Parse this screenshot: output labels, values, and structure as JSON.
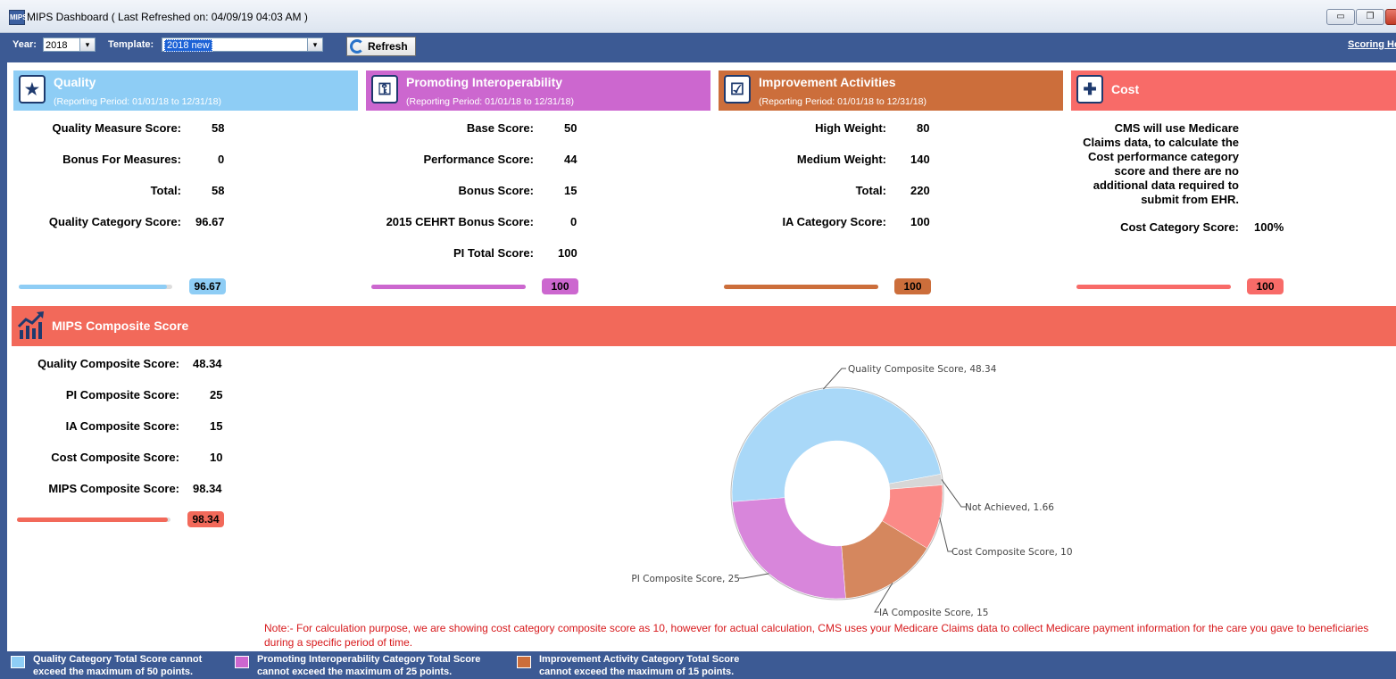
{
  "window": {
    "title": "MIPS Dashboard ( Last Refreshed on: 04/09/19 04:03 AM )",
    "app_icon_text": "MIPS",
    "minimize": "▭",
    "restore": "❐",
    "close": "✕"
  },
  "toolbar": {
    "year_label": "Year:",
    "year_value": "2018",
    "template_label": "Template:",
    "template_value": "2018 new",
    "refresh_label": "Refresh",
    "scoring_link": "Scoring He"
  },
  "quality": {
    "title": "Quality",
    "period": "(Reporting Period: 01/01/18 to 12/31/18)",
    "icon": "shield-star-icon",
    "color": "#8ecdf5",
    "rows": [
      {
        "label": "Quality Measure Score:",
        "value": "58"
      },
      {
        "label": "Bonus For Measures:",
        "value": "0"
      },
      {
        "label": "Total:",
        "value": "58"
      },
      {
        "label": "Quality Category Score:",
        "value": "96.67"
      }
    ],
    "progress": 0.9667,
    "badge": "96.67"
  },
  "pi": {
    "title": "Promoting Interoperability",
    "period": "(Reporting Period: 01/01/18 to 12/31/18)",
    "icon": "devices-icon",
    "color": "#cc67cf",
    "rows": [
      {
        "label": "Base Score:",
        "value": "50"
      },
      {
        "label": "Performance Score:",
        "value": "44"
      },
      {
        "label": "Bonus Score:",
        "value": "15"
      },
      {
        "label": "2015 CEHRT Bonus Score:",
        "value": "0"
      },
      {
        "label": "PI Total Score:",
        "value": "100"
      }
    ],
    "progress": 1.0,
    "badge": "100"
  },
  "ia": {
    "title": "Improvement Activities",
    "period": "(Reporting Period: 01/01/18 to 12/31/18)",
    "icon": "checklist-icon",
    "color": "#cc6e3b",
    "rows": [
      {
        "label": "High Weight:",
        "value": "80"
      },
      {
        "label": "Medium Weight:",
        "value": "140"
      },
      {
        "label": "Total:",
        "value": "220"
      },
      {
        "label": "IA Category Score:",
        "value": "100"
      }
    ],
    "progress": 1.0,
    "badge": "100"
  },
  "cost": {
    "title": "Cost",
    "icon": "hospital-icon",
    "color": "#f86b68",
    "description": "CMS will use Medicare Claims data, to calculate the Cost performance category score and there are no additional data required to submit from EHR.",
    "row": {
      "label": "Cost Category Score:",
      "value": "100%"
    },
    "progress": 1.0,
    "badge": "100"
  },
  "composite": {
    "title": "MIPS Composite Score",
    "icon": "trend-chart-icon",
    "color": "#f2695a",
    "rows": [
      {
        "label": "Quality Composite Score:",
        "value": "48.34"
      },
      {
        "label": "PI Composite Score:",
        "value": "25"
      },
      {
        "label": "IA Composite Score:",
        "value": "15"
      },
      {
        "label": "Cost Composite Score:",
        "value": "10"
      },
      {
        "label": "MIPS Composite Score:",
        "value": "98.34"
      }
    ],
    "progress": 0.9834,
    "badge": "98.34"
  },
  "chart_data": {
    "type": "pie",
    "title": "",
    "series": [
      {
        "label": "Quality Composite Score, 48.34",
        "value": 48.34,
        "color": "#a9d8f8"
      },
      {
        "label": "Not Achieved, 1.66",
        "value": 1.66,
        "color": "#d7d7d7"
      },
      {
        "label": "Cost Composite Score, 10",
        "value": 10,
        "color": "#fb8a87"
      },
      {
        "label": "IA Composite Score, 15",
        "value": 15,
        "color": "#d5875e"
      },
      {
        "label": "PI Composite Score, 25",
        "value": 25,
        "color": "#d886db"
      }
    ]
  },
  "note": "Note:- For calculation purpose, we are showing cost category composite score as 10, however for actual calculation, CMS uses your Medicare Claims data to collect Medicare payment information for the care you gave to beneficiaries during a specific period of time.",
  "legend": [
    {
      "text": "Quality Category Total Score cannot exceed the maximum of 50 points.",
      "color": "#8ecdf5"
    },
    {
      "text": "Promoting Interoperability Category Total Score cannot exceed the maximum of 25 points.",
      "color": "#cc67cf"
    },
    {
      "text": "Improvement Activity Category Total Score cannot exceed the maximum of 15 points.",
      "color": "#cc6e3b"
    }
  ]
}
